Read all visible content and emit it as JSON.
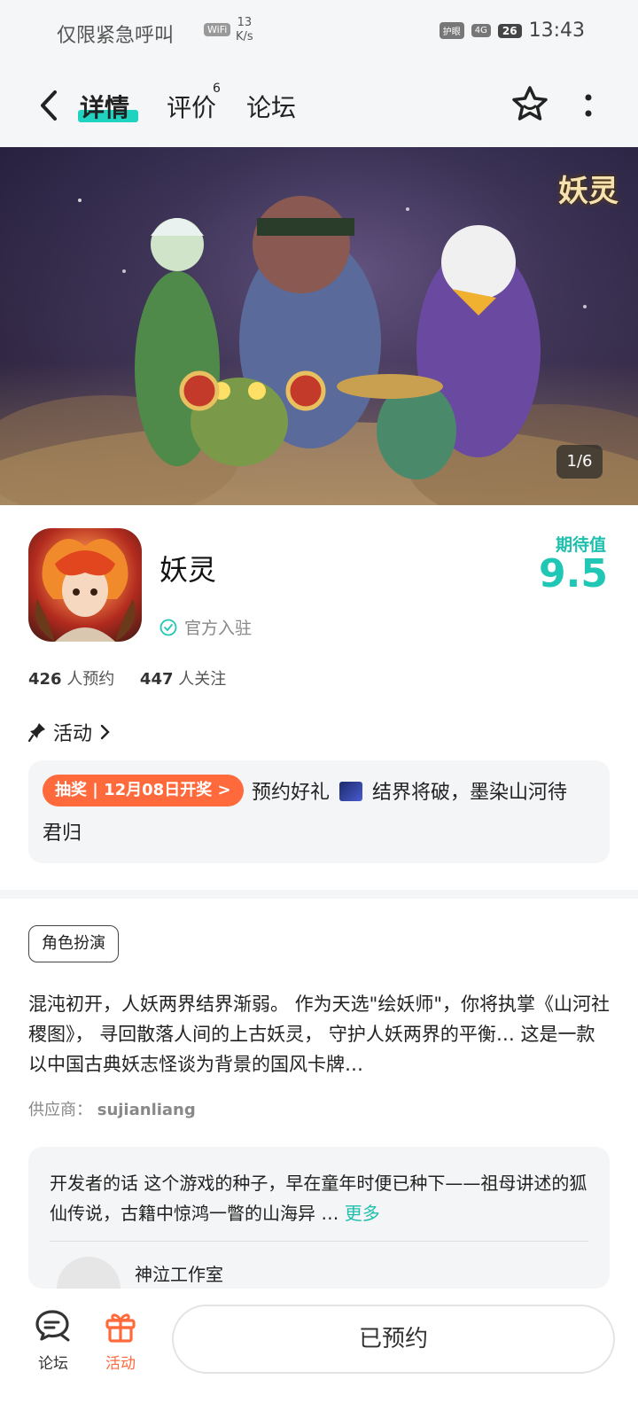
{
  "status_bar": {
    "carrier": "仅限紧急呼叫",
    "wifi_label": "WiFi",
    "speed_value": "13",
    "speed_unit": "K/s",
    "chip1": "护眼",
    "chip2": "4G",
    "battery": "26",
    "time": "13:43"
  },
  "nav": {
    "tabs": [
      {
        "label": "详情"
      },
      {
        "label": "评价"
      },
      {
        "label": "论坛"
      }
    ],
    "review_count": "6"
  },
  "banner": {
    "logo": "妖灵",
    "page_indicator": "1/6"
  },
  "game": {
    "name": "妖灵",
    "official_label": "官方入驻",
    "expectation_label": "期待值",
    "expectation_value": "9.5",
    "reservations_count": "426",
    "reservations_label": "人预约",
    "followers_count": "447",
    "followers_label": "人关注"
  },
  "activity": {
    "header": "活动",
    "badge": "抽奖 | 12月08日开奖 >",
    "text_line1": "预约好礼",
    "text_line1b": "结界将破，墨染山河待",
    "text_line2": "君归"
  },
  "description": {
    "tag": "角色扮演",
    "text": "混沌初开，人妖两界结界渐弱。 作为天选\"绘妖师\"，你将执掌《山河社稷图》， 寻回散落人间的上古妖灵， 守护人妖两界的平衡… 这是一款以中国古典妖志怪谈为背景的国风卡牌…",
    "supplier_label": "供应商：",
    "supplier_name": "sujianliang"
  },
  "developer": {
    "text": "开发者的话  这个游戏的种子，早在童年时便已种下——祖母讲述的狐仙传说，古籍中惊鸿一瞥的山海异 …",
    "more": "更多",
    "studio": "神泣工作室"
  },
  "bottom_bar": {
    "forum_label": "论坛",
    "activity_label": "活动",
    "reserve_label": "已预约"
  },
  "colors": {
    "accent": "#1fc7b4",
    "orange": "#ff6a3d"
  }
}
